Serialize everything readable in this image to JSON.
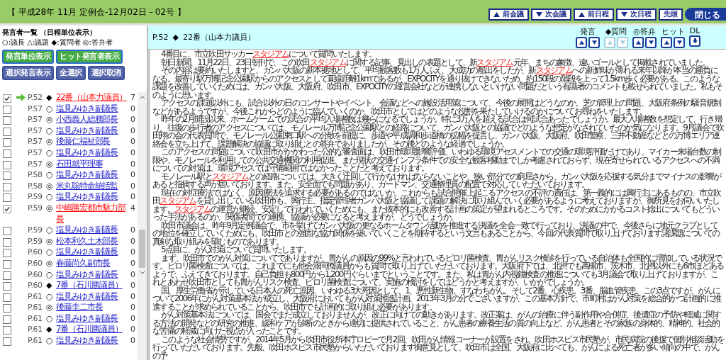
{
  "header": {
    "title": "【 平成28年 11月 定例会-12月02日－02号 】",
    "buttons": [
      {
        "label": "前会議",
        "kind": "up"
      },
      {
        "label": "次会議",
        "kind": "down"
      },
      {
        "label": "前日程",
        "kind": "up"
      },
      {
        "label": "次日程",
        "kind": "down"
      },
      {
        "label": "先頭",
        "kind": "plain"
      }
    ],
    "close": "閉じる"
  },
  "sidebar": {
    "title": "発言者一覧 （日程単位表示）",
    "legend": "○:議長 △:議題 ◆:質問者 ◎:答弁者",
    "green_buttons": [
      "発言単位表示",
      "ヒット発言者表示"
    ],
    "blue_buttons": [
      "選択発言表示",
      "全選択",
      "選択取消"
    ],
    "speakers": [
      {
        "checked": true,
        "current": true,
        "page": "P.52",
        "mark": "◆",
        "name": "22番（山本力議員）",
        "highlighted": true,
        "hits": "7"
      },
      {
        "checked": false,
        "current": false,
        "page": "P.57",
        "mark": "○",
        "name": "塩見みゆき副議長",
        "highlighted": false,
        "hits": "0"
      },
      {
        "checked": false,
        "current": false,
        "page": "P.57",
        "mark": "◎",
        "name": "小西義人総務部長",
        "highlighted": false,
        "hits": "0"
      },
      {
        "checked": false,
        "current": false,
        "page": "P.57",
        "mark": "○",
        "name": "塩見みゆき副議長",
        "highlighted": false,
        "hits": "0"
      },
      {
        "checked": false,
        "current": false,
        "page": "P.57",
        "mark": "◎",
        "name": "後藤仁福祉部長",
        "highlighted": false,
        "hits": "0"
      },
      {
        "checked": false,
        "current": false,
        "page": "P.57",
        "mark": "○",
        "name": "塩見みゆき副議長",
        "highlighted": false,
        "hits": "0"
      },
      {
        "checked": false,
        "current": false,
        "page": "P.57",
        "mark": "◎",
        "name": "石田就平理事",
        "highlighted": false,
        "hits": "0"
      },
      {
        "checked": false,
        "current": false,
        "page": "P.58",
        "mark": "○",
        "name": "塩見みゆき副議長",
        "highlighted": false,
        "hits": "0"
      },
      {
        "checked": false,
        "current": false,
        "page": "P.58",
        "mark": "◎",
        "name": "米丸聡特命統括監",
        "highlighted": false,
        "hits": "0"
      },
      {
        "checked": false,
        "current": false,
        "page": "P.59",
        "mark": "○",
        "name": "塩見みゆき副議長",
        "highlighted": false,
        "hits": "0"
      },
      {
        "checked": true,
        "current": false,
        "page": "P.59",
        "mark": "◎",
        "name": "中嶋勝宏都市魅力部長",
        "highlighted": true,
        "hits": "4"
      },
      {
        "checked": false,
        "current": false,
        "page": "P.59",
        "mark": "○",
        "name": "塩見みゆき副議長",
        "highlighted": false,
        "hits": "0"
      },
      {
        "checked": false,
        "current": false,
        "page": "P.59",
        "mark": "◎",
        "name": "松本利久土木部長",
        "highlighted": false,
        "hits": "0"
      },
      {
        "checked": false,
        "current": false,
        "page": "P.60",
        "mark": "○",
        "name": "塩見みゆき副議長",
        "highlighted": false,
        "hits": "0"
      },
      {
        "checked": false,
        "current": false,
        "page": "P.60",
        "mark": "◎",
        "name": "春藤尚久副市長",
        "highlighted": false,
        "hits": "0"
      },
      {
        "checked": false,
        "current": false,
        "page": "P.60",
        "mark": "○",
        "name": "塩見みゆき副議長",
        "highlighted": false,
        "hits": "0"
      },
      {
        "checked": false,
        "current": false,
        "page": "P.60",
        "mark": "◆",
        "name": "7番（石川勝議員）",
        "highlighted": false,
        "hits": "0"
      },
      {
        "checked": false,
        "current": false,
        "page": "P.61",
        "mark": "○",
        "name": "塩見みゆき副議長",
        "highlighted": false,
        "hits": "0"
      },
      {
        "checked": false,
        "current": false,
        "page": "P.61",
        "mark": "◎",
        "name": "後藤圭二市長",
        "highlighted": false,
        "hits": "0"
      },
      {
        "checked": false,
        "current": false,
        "page": "P.61",
        "mark": "○",
        "name": "塩見みゆき副議長",
        "highlighted": false,
        "hits": "0"
      },
      {
        "checked": false,
        "current": false,
        "page": "P.61",
        "mark": "◆",
        "name": "7番（石川勝議員）",
        "highlighted": false,
        "hits": "0"
      },
      {
        "checked": false,
        "current": false,
        "page": "P.61",
        "mark": "○",
        "name": "塩見みゆき副議長",
        "highlighted": false,
        "hits": "0"
      }
    ]
  },
  "speech": {
    "page": "P.52",
    "mark": "◆",
    "speaker": "22番（山本力議員）",
    "nav": [
      {
        "label": "発言",
        "kind": "updown",
        "disabled": false
      },
      {
        "label": "◆質問",
        "kind": "updown",
        "disabled": true
      },
      {
        "label": "◎答弁",
        "kind": "updown",
        "disabled": false
      },
      {
        "label": "ヒット",
        "kind": "updown",
        "disabled": false
      },
      {
        "label": "DL",
        "kind": "download",
        "disabled": false
      }
    ],
    "paragraphs": [
      [
        {
          "text": "4番目に、市立吹田サッカー",
          "hit": false
        },
        {
          "text": "スタジアム",
          "hit": true
        },
        {
          "text": "について質問いたします。",
          "hit": false
        }
      ],
      [
        {
          "text": "朝日新聞、11月22日、23日朝刊で、この吹田",
          "hit": false
        },
        {
          "text": "スタジアム",
          "hit": true
        },
        {
          "text": "に関する記事、見出しの表題として、新",
          "hit": false
        },
        {
          "text": "スタジアム",
          "hit": true
        },
        {
          "text": "元年、まちの象徴、遠いゴールとして掲載されていました。",
          "hit": false
        }
      ],
      [
        {
          "text": "その内容は要約いたしますと、ガンバ大阪の新本拠地として、平均観客数も1万人ふえ、大成功の船出をしたが、新",
          "hit": false
        },
        {
          "text": "スタジアム",
          "hit": true
        },
        {
          "text": "への新鮮味が薄れる来年以降が本当の勝負になる。最寄り駅万博記念公園駅からのアクセスとして直線距離1kmであるが、EXPOCITYを通り抜けできないため、約150段の階段を上って1.5km歩く必要がある。このような課題を改善していくためには、ガンバ大阪、大阪府、吹田市、EXPOCITYの運営会社などが連携しないといけない問題だという有識者のコメントも載せられていました。私もそのように思います。",
          "hit": false
        }
      ],
      [
        {
          "text": "アクセスの課題以外にも、試合以外の日のコンサートやイベント、会議などへの施設活用策について、今後の展開はどうなのか。芝の管理上の問題、大阪府条例の騒音規制などがあるようですが、今後これからどのように臨んでいくのか、吹田市としてはどのような役割を果たしていけるのかについてお尋ねをいたします。",
          "hit": false
        }
      ],
      [
        {
          "text": "昨年の2月開設以来、ホームゲームでの試合の平均入場者数は幾らになるでしょうか。特に3万人を超える試合は何試合あったでしょうか。最大入場者数を想定して、行き帰り、往復の歩行者のアクセスについては、モノレール万博記念公園駅との経路について、ガンバ大阪との協議でどのような想定がなされていたのか気になります。9月議会で吹田翔の会の代表質問で、モノレール公園東口駅への分散を前提に、歩道や平成調和歩道橋の拡幅を提言し、ガンバ大阪、大阪府、吹田警察、三井不動産などとの万博エリア連絡会を立ち上げて、課題解決の協議に取り組むとの答弁でありましたが、その後どのような経過でしょうか。",
          "hit": false
        }
      ],
      [
        {
          "text": "このアクセスの問題について吹田市がかかわった公的な審査面は、吹田市環境影響評価、いわゆる環境アセスメントでの交通の環境評価だけであり、マイカー来場台数の制限や、モノレールを利用しての公共交通機関の利用促進、また現状の交通インフラ条件での安全な観客移動までしか考慮されておらず、現在寄せられているアクセスへの不満についての対策は、環境アセスでは守備範囲ではなかったことだと考えております。",
          "hit": false
        }
      ],
      [
        {
          "text": "モノレール駅と",
          "hit": false
        },
        {
          "text": "スタジアム",
          "hit": true
        },
        {
          "text": "との経路については、大きく迂回して行かなければならないことや、狭い部分での窮屈さから、ガンバ大阪を応援する気分までマイナスの影響があると指摘する声が届いております。また、安全面でも問題があり、ガードマン、交通整理員の配置で対応していただいております。",
          "hit": false
        }
      ],
      [
        {
          "text": "現在の対症療法ではなく、原因療法を追求する必要があるのではないか。これからも試合開催上起こるアクセスの不評の責任は、第一義的には興行主にあるものの、市立吹田",
          "hit": false
        },
        {
          "text": "スタジアム",
          "hit": true
        },
        {
          "text": "を貸し出している吹田市も、興行主、指定管理者ガンバ大阪と協議して課題の解決に取り組んでいく必要があるように考えておりますが、御所見をお伺いいたします。",
          "hit": false
        },
        {
          "text": "スタジアム",
          "hit": true
        },
        {
          "text": "の運営が継続、安定して行われていくためにも、また抜本的にも改善する計画の策定が望まれるところです。そのためにかかるコスト捻出についてもどういった手法があるのか、関係者間での連携、協議が必要になると考えますが、どうでしょうか。",
          "hit": false
        }
      ],
      [
        {
          "text": "吹田市議会は、昨年9月定例議会で、市を挙げてガンバ大阪の更なるホームタウン活動を推進する決議を全会一致で行っており、決議の中で、今後さらに地元クラブとしての地位を確立していくためにも、吹田市との強固な協力関係を築いていくことを期待するという文言もあることから、今回の代表質問で取り上げております諸課題についての真剣な取り組みを望むものであります。",
          "hit": false
        }
      ],
      [
        {
          "text": "5点目に、がん対策について質問いたします。",
          "hit": false
        }
      ],
      [
        {
          "text": "まず、吹田市でのがん対策についてでありますが、胃がんの原因の99%と言われているピロリ菌検査、胃がんリスク検診を行っている自治体も全国的に増加している状況です。ピロリ菌検査については、これまでにも他会派同僚議員からも質問で取り上げていただいております。大阪府下では、北摂でも高槻市、茨木市、北摂以外にも6市ほどあるようで、ふえてきております。自己負担も800円から1,200円ぐらいまでということです。また、私は胃がん内視鏡検査の推進についても3月議会で取り上げておりますが、これとあわせ吹田市としても胃がんリスク検査、ピロリ菌検査について、実施の検討をしてはどうかと考えますが、いかがでしょうか。",
          "hit": false
        }
      ],
      [
        {
          "text": "国、厚生労働省が示している日本人の死亡原因、いわゆる3大死因として、1、悪性新生物、すなわちがん。そして2番、心疾患。3番、脳血管疾患。この3点ですが、がんについて2006年にがん対策基本法が成立し、大阪府においてもがん対策推進計画、2013年3月の分でございますが、この基本方針で、市町村はがん対策を総合的かつ計画的に推進することが求められていることから、吹田市でも計画的に取り組む必要があります。",
          "hit": false
        }
      ],
      [
        {
          "text": "がん対策基本法については、国会でまだ成立しておりませんが、改正に向けての動きがあります。改正案は、がんの治療に伴う副作用や合併症、後遺症の予防や軽減に関する方法の開発などの研究の推進、緩和ケアが診断のときから適切に提供されていること、がん患者の療養生活の質の向上など、がん患者とその家族の身体的、精神的、社会的な苦痛の軽減に向けた視点が入ったことです。",
          "hit": false
        }
      ],
      [
        {
          "text": "このような社会情勢ですが、2014年5月から吹田市役所本庁ロビーで月2回、吹田がん情報コーナーが設置をされ、吹田ホスピス市民塾が、市民病院の後援で個別相談活動を行っていただいております。先般、吹田ホスピス市民塾からいただいております御意見として、吹田市は全国、大阪府に比べても、がんによる死亡者が多い傾向の中で、がんの予",
          "hit": false
        }
      ]
    ]
  }
}
